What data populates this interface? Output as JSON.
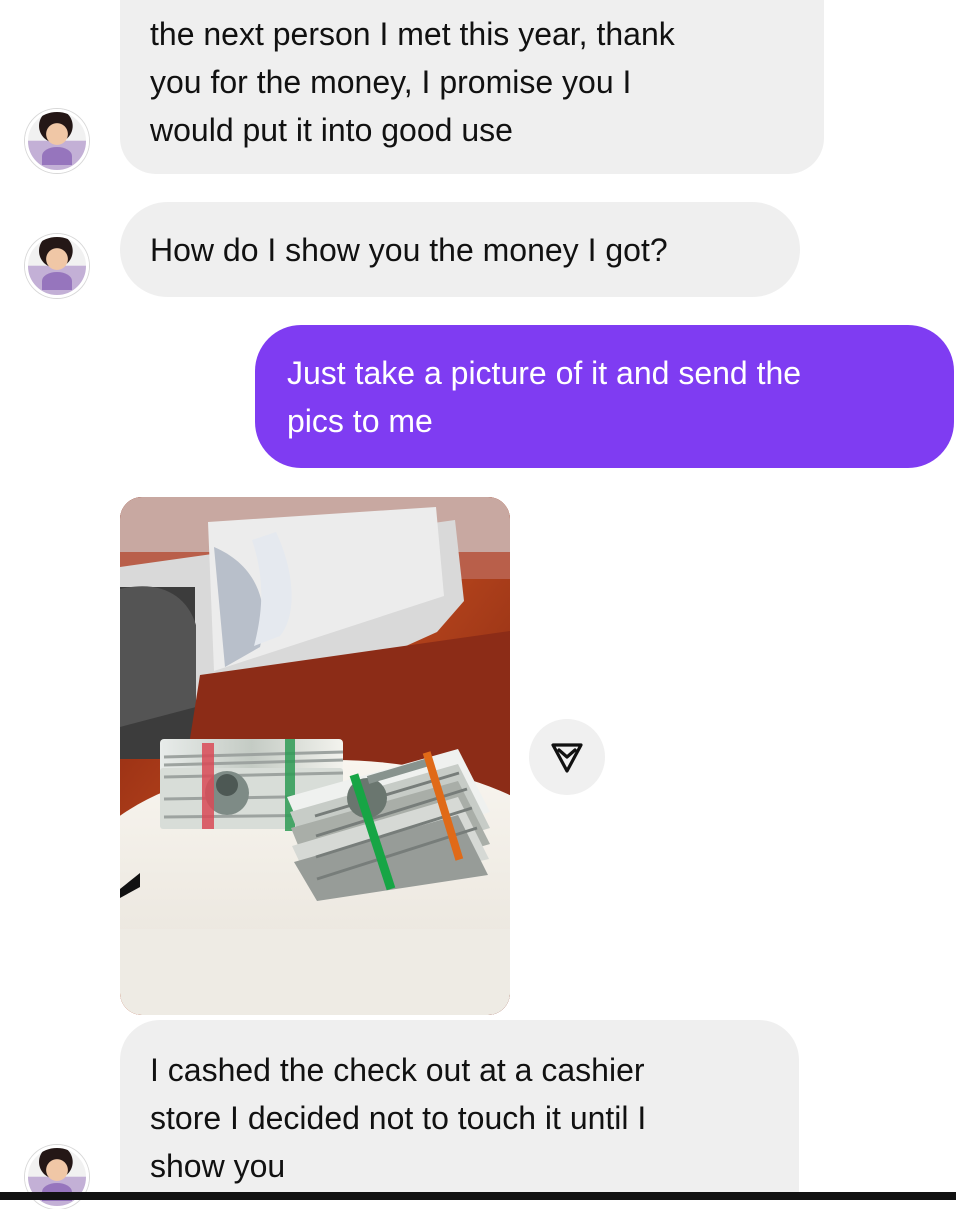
{
  "conversation": {
    "messages": [
      {
        "sender": "them",
        "text": "the next person I met this year, thank\nyou for the money, I promise you I\nwould put it into good use"
      },
      {
        "sender": "them",
        "text": "How do I show you the money I got?"
      },
      {
        "sender": "me",
        "text": "Just take a picture of it and send the\npics to me"
      },
      {
        "sender": "them",
        "type": "image",
        "alt": "stacks of cash on a white round table",
        "share_icon": "share-icon"
      },
      {
        "sender": "them",
        "text": "I cashed the check out at a cashier\nstore I decided not to touch it until I\nshow you"
      }
    ]
  },
  "colors": {
    "incoming_bubble": "#efefef",
    "outgoing_bubble": "#7f3cf2",
    "outgoing_text": "#ffffff",
    "background": "#ffffff"
  },
  "icons": {
    "avatar": "contact-avatar",
    "share": "share-icon"
  }
}
